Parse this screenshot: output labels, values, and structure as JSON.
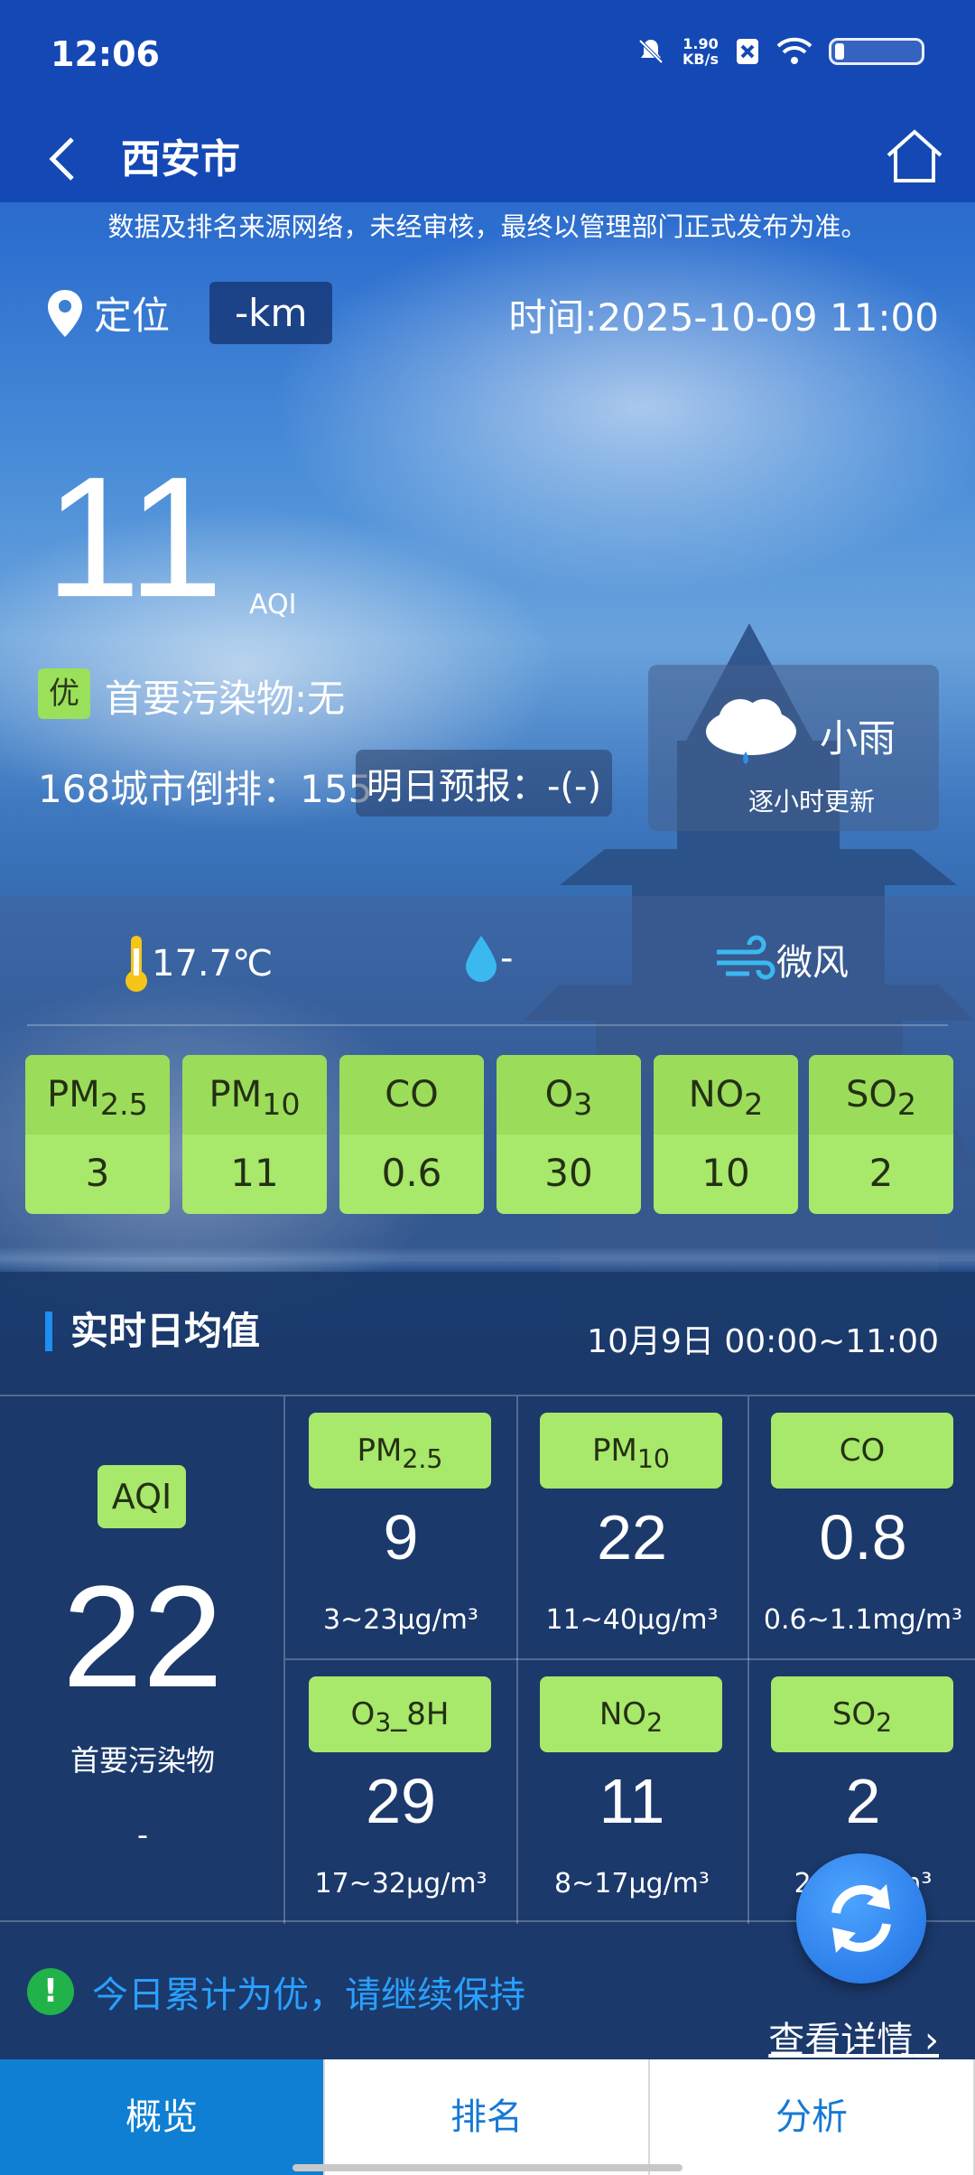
{
  "status_bar": {
    "time": "12:06",
    "speed_value": "1.90",
    "speed_unit": "KB/s"
  },
  "header": {
    "title": "西安市"
  },
  "notice": "数据及排名来源网络，未经审核，最终以管理部门正式发布为准。",
  "location": {
    "label": "定位",
    "distance": "-km",
    "time": "时间:2025-10-09 11:00"
  },
  "current": {
    "aqi": "11",
    "aqi_label": "AQI",
    "level": "优",
    "primary_pollutant": "首要污染物:无",
    "rank": "168城市倒排：155",
    "forecast": "明日预报：-(-)"
  },
  "weather": {
    "condition": "小雨",
    "update": "逐小时更新",
    "temperature": "17.7℃",
    "humidity": "-",
    "wind": "微风"
  },
  "pollutants": [
    {
      "base": "PM",
      "sub": "2.5",
      "value": "3"
    },
    {
      "base": "PM",
      "sub": "10",
      "value": "11"
    },
    {
      "base": "CO",
      "sub": "",
      "value": "0.6"
    },
    {
      "base": "O",
      "sub": "3",
      "value": "30"
    },
    {
      "base": "NO",
      "sub": "2",
      "value": "10"
    },
    {
      "base": "SO",
      "sub": "2",
      "value": "2"
    }
  ],
  "daily": {
    "title": "实时日均值",
    "range": "10月9日 00:00~11:00",
    "aqi_label": "AQI",
    "aqi_value": "22",
    "primary_label": "首要污染物",
    "primary_value": "-",
    "items": [
      {
        "base": "PM",
        "sub": "2.5",
        "value": "9",
        "range": "3~23μg/m³"
      },
      {
        "base": "PM",
        "sub": "10",
        "value": "22",
        "range": "11~40μg/m³"
      },
      {
        "base": "CO",
        "sub": "",
        "value": "0.8",
        "range": "0.6~1.1mg/m³"
      },
      {
        "base": "O",
        "sub": "3",
        "tail": "_8H",
        "value": "29",
        "range": "17~32μg/m³"
      },
      {
        "base": "NO",
        "sub": "2",
        "value": "11",
        "range": "8~17μg/m³"
      },
      {
        "base": "SO",
        "sub": "2",
        "value": "2",
        "range": "2~4μg/m³"
      }
    ]
  },
  "tip": "今日累计为优，请继续保持",
  "detail_link": "查看详情",
  "tabs": [
    "概览",
    "排名",
    "分析"
  ],
  "colors": {
    "good_green": "#a8e86a",
    "header_blue": "#1448b5",
    "tab_active": "#0e7fd3"
  }
}
